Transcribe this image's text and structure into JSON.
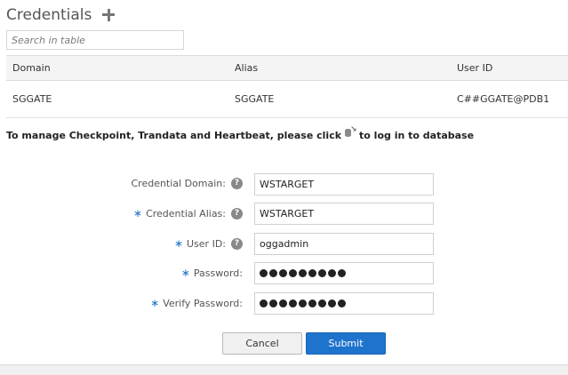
{
  "header": {
    "title": "Credentials",
    "add_icon": "plus-icon"
  },
  "search": {
    "placeholder": "Search in table",
    "value": ""
  },
  "table": {
    "columns": [
      "Domain",
      "Alias",
      "User ID"
    ],
    "rows": [
      {
        "domain": "SGGATE",
        "alias": "SGGATE",
        "user_id": "C##GGATE@PDB1"
      }
    ]
  },
  "manage": {
    "before": "To manage Checkpoint, Trandata and Heartbeat, please click",
    "icon": "database-login-icon",
    "after": "to log in to database"
  },
  "form": {
    "required_marker": "∗",
    "help_glyph": "?",
    "credential_domain": {
      "label": "Credential Domain:",
      "value": "WSTARGET"
    },
    "credential_alias": {
      "label": "Credential Alias:",
      "value": "WSTARGET"
    },
    "user_id": {
      "label": "User ID:",
      "value": "oggadmin"
    },
    "password": {
      "label": "Password:",
      "masked_length": 9
    },
    "verify_password": {
      "label": "Verify Password:",
      "masked_length": 9
    }
  },
  "buttons": {
    "cancel": "Cancel",
    "submit": "Submit"
  },
  "colors": {
    "primary": "#1e73cd",
    "required": "#1f73c9"
  }
}
